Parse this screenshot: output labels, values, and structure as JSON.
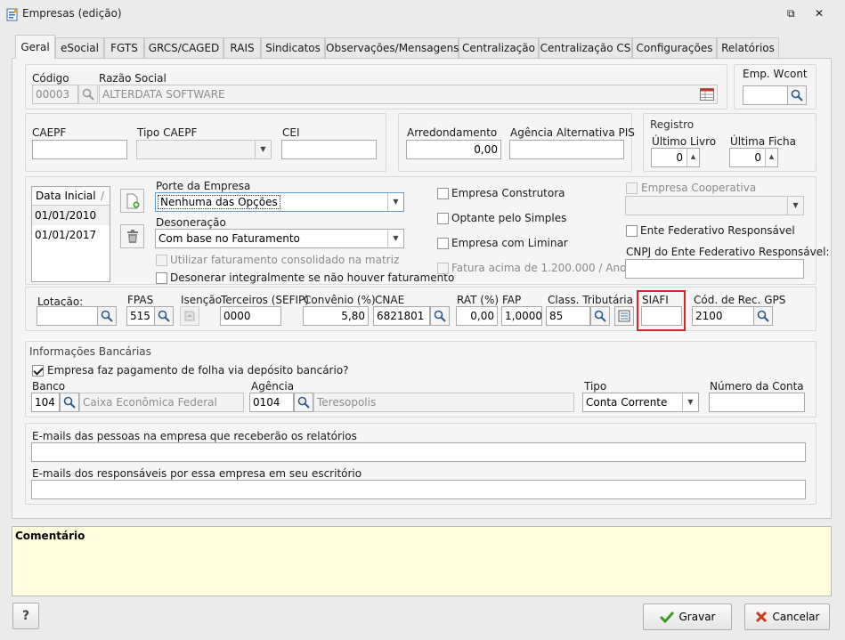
{
  "window": {
    "title": "Empresas (edição)",
    "restore_glyph": "⧉",
    "close_glyph": "✕"
  },
  "tabs": [
    "Geral",
    "eSocial",
    "FGTS",
    "GRCS/CAGED",
    "RAIS",
    "Sindicatos",
    "Observações/Mensagens",
    "Centralização",
    "Centralização CS",
    "Configurações",
    "Relatórios"
  ],
  "company": {
    "codigo_label": "Código",
    "codigo_value": "00003",
    "razao_label": "Razão Social",
    "razao_value": "ALTERDATA SOFTWARE",
    "wcont_label": "Emp. Wcont",
    "wcont_value": ""
  },
  "caepf": {
    "caepf_label": "CAEPF",
    "caepf_value": "",
    "tipo_label": "Tipo CAEPF",
    "tipo_value": "",
    "cei_label": "CEI",
    "cei_value": "",
    "arred_label": "Arredondamento",
    "arred_value": "0,00",
    "agencia_pis_label": "Agência Alternativa PIS",
    "agencia_pis_value": ""
  },
  "registro": {
    "legend": "Registro",
    "ultimo_livro_label": "Último Livro",
    "ultimo_livro_value": "0",
    "ultima_ficha_label": "Última Ficha",
    "ultima_ficha_value": "0"
  },
  "dates": {
    "header": "Data Inicial",
    "rows": [
      "01/01/2010",
      "01/01/2017"
    ]
  },
  "porte": {
    "label": "Porte da Empresa",
    "value": "Nenhuma das Opções"
  },
  "desoneracao": {
    "label": "Desoneração",
    "value": "Com base no Faturamento",
    "check1": "Utilizar faturamento consolidado na matriz",
    "check2": "Desonerar integralmente se não houver faturamento"
  },
  "options": {
    "construtora": "Empresa Construtora",
    "simples": "Optante pelo Simples",
    "liminar": "Empresa com Liminar",
    "fatura": "Fatura acima de 1.200.000 / Ano",
    "cooperativa": "Empresa Cooperativa",
    "cooperativa_value": "",
    "ente_federativo": "Ente Federativo Responsável",
    "cnpj_ente_label": "CNPJ do Ente Federativo Responsável:",
    "cnpj_ente_value": ""
  },
  "tax": {
    "lotacao_label": "Lotação:",
    "lotacao_value": "",
    "fpas_label": "FPAS",
    "fpas_value": "515",
    "isencao_label": "Isenção",
    "terceiros_label": "Terceiros (SEFIP)",
    "terceiros_value": "0000",
    "convenio_label": "Convênio (%)",
    "convenio_value": "5,80",
    "cnae_label": "CNAE",
    "cnae_value": "6821801",
    "rat_label": "RAT (%)",
    "rat_value": "0,00",
    "fap_label": "FAP",
    "fap_value": "1,0000",
    "class_label": "Class. Tributária",
    "class_value": "85",
    "siafi_label": "SIAFI",
    "siafi_value": "",
    "gps_label": "Cód. de Rec. GPS",
    "gps_value": "2100"
  },
  "bank": {
    "legend": "Informações Bancárias",
    "deposit_check": "Empresa faz pagamento de folha via depósito bancário?",
    "banco_label": "Banco",
    "banco_code": "104",
    "banco_name": "Caixa Econômica Federal",
    "agencia_label": "Agência",
    "agencia_code": "0104",
    "agencia_name": "Teresopolis",
    "tipo_label": "Tipo",
    "tipo_value": "Conta Corrente",
    "conta_label": "Número da Conta",
    "conta_value": ""
  },
  "emails": {
    "label1": "E-mails das pessoas na empresa que receberão os relatórios",
    "value1": "",
    "label2": "E-mails dos responsáveis por essa empresa em seu escritório",
    "value2": ""
  },
  "comentario": {
    "label": "Comentário"
  },
  "footer": {
    "help": "?",
    "save": "Gravar",
    "cancel": "Cancelar"
  },
  "colors": {
    "highlight": "#d9232a",
    "comment_bg": "#ffffe0",
    "accent_check": "#3a9a1f",
    "cancel_x": "#d2391c"
  }
}
